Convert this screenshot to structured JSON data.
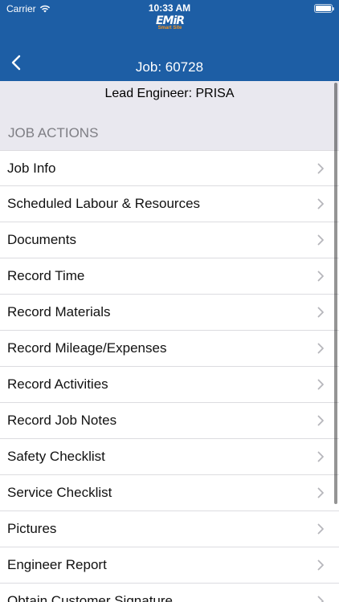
{
  "status_bar": {
    "carrier": "Carrier",
    "time": "10:33 AM",
    "wifi_icon": "wifi-icon",
    "battery_icon": "battery-icon"
  },
  "logo": {
    "main": "EMiR",
    "sub": "Smart Site"
  },
  "nav": {
    "title": "Job: 60728",
    "back_icon": "chevron-left-icon"
  },
  "job": {
    "lead_engineer": "Lead Engineer: PRISA"
  },
  "section": {
    "title": "JOB ACTIONS"
  },
  "actions": [
    {
      "label": "Job Info"
    },
    {
      "label": "Scheduled Labour & Resources"
    },
    {
      "label": "Documents"
    },
    {
      "label": "Record Time"
    },
    {
      "label": "Record Materials"
    },
    {
      "label": "Record Mileage/Expenses"
    },
    {
      "label": "Record Activities"
    },
    {
      "label": "Record Job Notes"
    },
    {
      "label": "Safety Checklist"
    },
    {
      "label": "Service Checklist"
    },
    {
      "label": "Pictures"
    },
    {
      "label": "Engineer Report"
    },
    {
      "label": "Obtain Customer Signature"
    }
  ],
  "colors": {
    "header": "#1d5ea5",
    "logo_accent": "#f7941d",
    "section_bg": "#e9e8ef"
  }
}
